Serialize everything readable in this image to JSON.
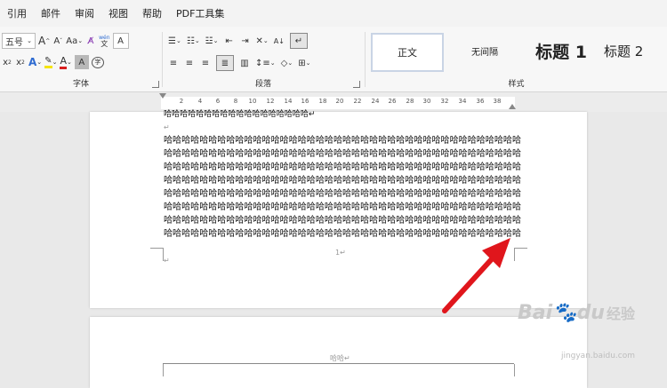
{
  "menu": [
    "引用",
    "邮件",
    "审阅",
    "视图",
    "帮助",
    "PDF工具集"
  ],
  "font_group": {
    "size": "五号",
    "label": "字体",
    "grow": "A",
    "shrink": "A",
    "case": "Aa",
    "pinyin_top": "wén",
    "pinyin_bottom": "文",
    "bordered": "A",
    "sub": "x",
    "super": "x",
    "effects": "A",
    "font_color": "A",
    "shaded": "A",
    "enclose": "字"
  },
  "paragraph_group": {
    "label": "段落",
    "sort": "A↓"
  },
  "styles_group": {
    "label": "样式",
    "items": [
      "正文",
      "无间隔",
      "标题 1",
      "标题 2"
    ]
  },
  "ruler": {
    "ticks": [
      "2",
      "2",
      "4",
      "6",
      "8",
      "10",
      "12",
      "14",
      "16",
      "18",
      "20",
      "22",
      "24",
      "26",
      "28",
      "30",
      "32",
      "34",
      "36",
      "38"
    ]
  },
  "document": {
    "first_line": "哈哈哈哈哈哈哈哈哈哈哈哈哈哈哈哈哈哈↵",
    "para_mark": "↵",
    "lines": [
      "哈哈哈哈哈哈哈哈哈哈哈哈哈哈哈哈哈哈哈哈哈哈哈哈哈哈哈哈哈哈哈哈哈哈哈哈哈哈哈哈",
      "哈哈哈哈哈哈哈哈哈哈哈哈哈哈哈哈哈哈哈哈哈哈哈哈哈哈哈哈哈哈哈哈哈哈哈哈哈哈哈哈",
      "哈哈哈哈哈哈哈哈哈哈哈哈哈哈哈哈哈哈哈哈哈哈哈哈哈哈哈哈哈哈哈哈哈哈哈哈哈哈哈哈",
      "哈哈哈哈哈哈哈哈哈哈哈哈哈哈哈哈哈哈哈哈哈哈哈哈哈哈哈哈哈哈哈哈哈哈哈哈哈哈哈哈",
      "哈哈哈哈哈哈哈哈哈哈哈哈哈哈哈哈哈哈哈哈哈哈哈哈哈哈哈哈哈哈哈哈哈哈哈哈哈哈哈哈",
      "哈哈哈哈哈哈哈哈哈哈哈哈哈哈哈哈哈哈哈哈哈哈哈哈哈哈哈哈哈哈哈哈哈哈哈哈哈哈哈哈",
      "哈哈哈哈哈哈哈哈哈哈哈哈哈哈哈哈哈哈哈哈哈哈哈哈哈哈哈哈哈哈哈哈哈哈哈哈哈哈哈哈",
      "哈哈哈哈哈哈哈哈哈哈哈哈哈哈哈哈哈哈哈哈哈哈哈哈哈哈哈哈哈哈哈哈哈哈哈哈哈哈哈哈",
      "哈哈哈哈哈哈哈哈哈哈哈哈哈哈哈哈哈哈哈哈哈哈哈哈哈哈哈哈哈哈哈哈哈哈哈哈哈哈哈哈"
    ],
    "page_number": "1↵",
    "footer_mark": "↵",
    "next_header": "哈哈↵"
  },
  "watermark": {
    "brand": "Bai",
    "brand2": "du",
    "suffix": "经验",
    "url": "jingyan.baidu.com"
  },
  "colors": {
    "arrow": "#e0161c",
    "highlight": "#f5e400",
    "font_color": "#d81e1e",
    "effects": "#2e6bd1"
  }
}
